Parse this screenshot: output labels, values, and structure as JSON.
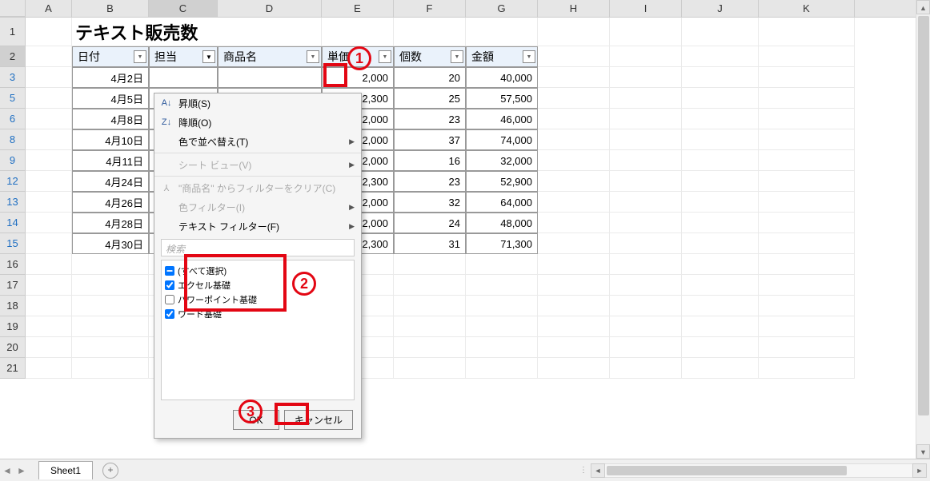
{
  "columns": [
    "A",
    "B",
    "C",
    "D",
    "E",
    "F",
    "G",
    "H",
    "I",
    "J",
    "K"
  ],
  "title": "テキスト販売数",
  "headers": {
    "date": "日付",
    "staff": "担当",
    "product": "商品名",
    "price": "単価",
    "qty": "個数",
    "amount": "金額"
  },
  "row_numbers": [
    "1",
    "2",
    "3",
    "5",
    "6",
    "8",
    "9",
    "12",
    "13",
    "14",
    "15",
    "16",
    "17",
    "18",
    "19",
    "20",
    "21"
  ],
  "rows": [
    {
      "date": "4月2日",
      "price": "2,000",
      "qty": "20",
      "amount": "40,000"
    },
    {
      "date": "4月5日",
      "price": "2,300",
      "qty": "25",
      "amount": "57,500"
    },
    {
      "date": "4月8日",
      "price": "2,000",
      "qty": "23",
      "amount": "46,000"
    },
    {
      "date": "4月10日",
      "price": "2,000",
      "qty": "37",
      "amount": "74,000"
    },
    {
      "date": "4月11日",
      "price": "2,000",
      "qty": "16",
      "amount": "32,000"
    },
    {
      "date": "4月24日",
      "price": "2,300",
      "qty": "23",
      "amount": "52,900"
    },
    {
      "date": "4月26日",
      "price": "2,000",
      "qty": "32",
      "amount": "64,000"
    },
    {
      "date": "4月28日",
      "price": "2,000",
      "qty": "24",
      "amount": "48,000"
    },
    {
      "date": "4月30日",
      "price": "2,300",
      "qty": "31",
      "amount": "71,300"
    }
  ],
  "dropdown": {
    "sort_asc": "昇順(S)",
    "sort_desc": "降順(O)",
    "sort_color": "色で並べ替え(T)",
    "sheet_view": "シート ビュー(V)",
    "clear_filter": "\"商品名\" からフィルターをクリア(C)",
    "color_filter": "色フィルター(I)",
    "text_filter": "テキスト フィルター(F)",
    "search": "検索",
    "all": "(すべて選択)",
    "items": [
      "エクセル基礎",
      "パワーポイント基礎",
      "ワード基礎"
    ],
    "ok": "OK",
    "cancel": "キャンセル"
  },
  "annotations": {
    "a1": "1",
    "a2": "2",
    "a3": "3"
  },
  "sheet_tab": "Sheet1"
}
